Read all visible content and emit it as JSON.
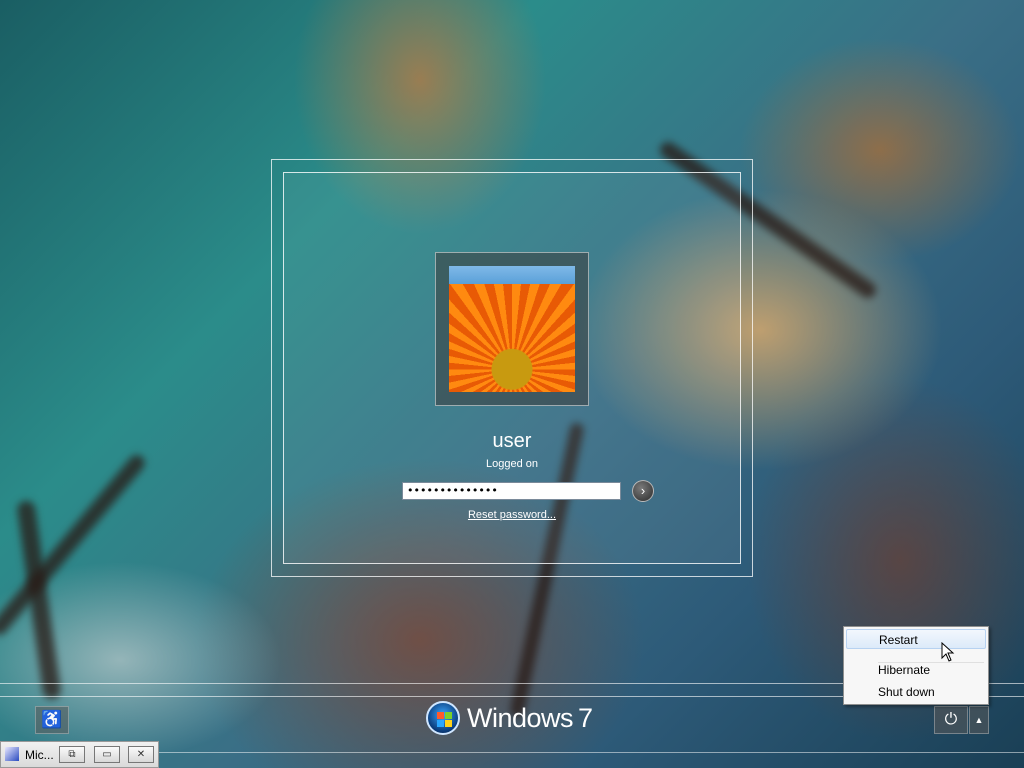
{
  "login": {
    "user_name": "user",
    "status": "Logged on",
    "password_mask": "••••••••••••••",
    "submit_glyph": "›",
    "reset_link": "Reset password..."
  },
  "bottom": {
    "brand_text": "Windows",
    "brand_version": "7",
    "ease_of_access_glyph": "♿",
    "power_glyph": "⏻",
    "arrow_glyph": "▲"
  },
  "power_menu": {
    "items": [
      "Restart",
      "Hibernate",
      "Shut down"
    ],
    "highlighted": "Restart"
  },
  "minimized_window": {
    "label": "Mic...",
    "restore_glyph": "⧉",
    "maximize_glyph": "▭",
    "close_glyph": "✕"
  },
  "icons": [
    "ease-of-access-icon",
    "windows-logo-icon",
    "power-icon",
    "chevron-up-icon",
    "submit-arrow-icon",
    "app-icon"
  ]
}
